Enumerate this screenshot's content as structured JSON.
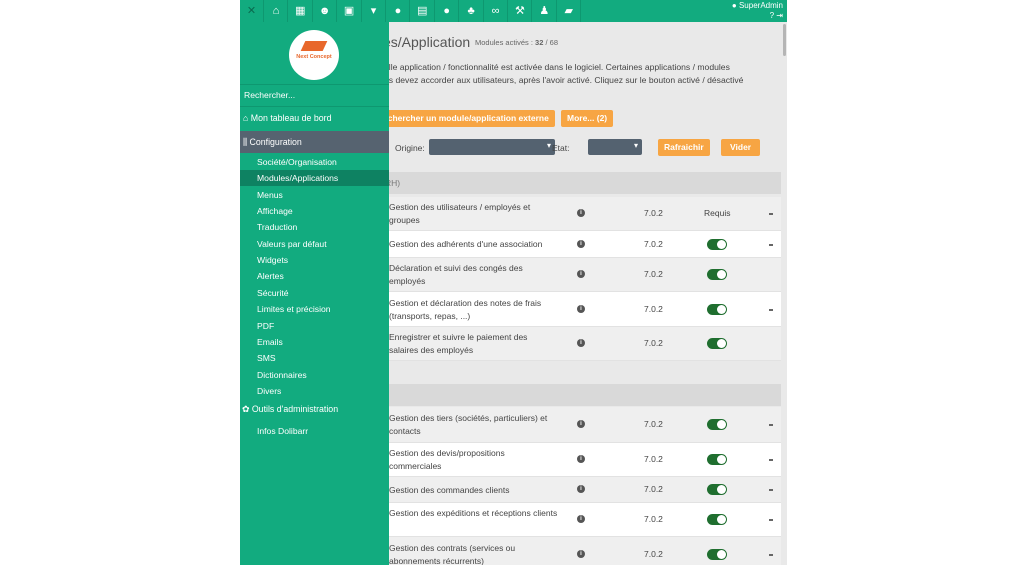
{
  "topbar": {
    "icons": [
      "close-icon",
      "home-icon",
      "calendar-icon",
      "users-icon",
      "archive-icon",
      "tie-icon",
      "piggy-bank-icon",
      "safe-icon",
      "piggy-bank-icon",
      "sitemap-icon",
      "binoculars-icon",
      "gavel-icon",
      "user-tie-icon",
      "folder-open-icon"
    ],
    "user": "SuperAdmin"
  },
  "sidebar": {
    "logo_text": "Next Concept",
    "search_placeholder": "Rechercher...",
    "dashboard": "Mon tableau de bord",
    "configuration": "Configuration",
    "config_items": [
      "Société/Organisation",
      "Modules/Applications",
      "Menus",
      "Affichage",
      "Traduction",
      "Valeurs par défaut",
      "Widgets",
      "Alertes",
      "Sécurité",
      "Limites et précision",
      "PDF",
      "Emails",
      "SMS",
      "Dictionnaires",
      "Divers"
    ],
    "admin_tools": "Outils d'administration",
    "infos": "Infos Dolibarr"
  },
  "main": {
    "title": "es/Application",
    "modules_label": "Modules activés :",
    "modules_count": "32",
    "modules_total": "/ 68",
    "desc1": "elle application / fonctionnalité est activée dans le logiciel. Certaines applications / modules",
    "desc2": "us devez accorder aux utilisateurs, après l'avoir activé. Cliquez sur le bouton activé / désactivé",
    "search_ext": "echercher un module/application externe",
    "more": "More... (2)",
    "origin_label": "Origine:",
    "state_label": "Etat:",
    "refresh": "Rafraichir",
    "clear": "Vider",
    "group1": "RH)",
    "group2": "",
    "rows1": [
      {
        "name": "Gestion des utilisateurs / employés et groupes",
        "version": "7.0.2",
        "status": "Requis",
        "dash": true
      },
      {
        "name": "Gestion des adhérents d'une association",
        "version": "7.0.2",
        "status": "on",
        "dash": true
      },
      {
        "name": "Déclaration et suivi des congés des employés",
        "version": "7.0.2",
        "status": "on",
        "dash": false
      },
      {
        "name": "Gestion et déclaration des notes de frais (transports, repas, ...)",
        "version": "7.0.2",
        "status": "on",
        "dash": true
      },
      {
        "name": "Enregistrer et suivre le paiement des salaires des employés",
        "version": "7.0.2",
        "status": "on",
        "dash": false
      }
    ],
    "rows2": [
      {
        "name": "Gestion des tiers (sociétés, particuliers) et contacts",
        "version": "7.0.2",
        "status": "on",
        "dash": true
      },
      {
        "name": "Gestion des devis/propositions commerciales",
        "version": "7.0.2",
        "status": "on",
        "dash": true
      },
      {
        "name": "Gestion des commandes clients",
        "version": "7.0.2",
        "status": "on",
        "dash": true
      },
      {
        "name": "Gestion des expéditions et réceptions clients",
        "version": "7.0.2",
        "status": "on",
        "dash": true
      },
      {
        "name": "Gestion des contrats (services ou abonnements récurrents)",
        "version": "7.0.2",
        "status": "on",
        "dash": true
      }
    ]
  }
}
